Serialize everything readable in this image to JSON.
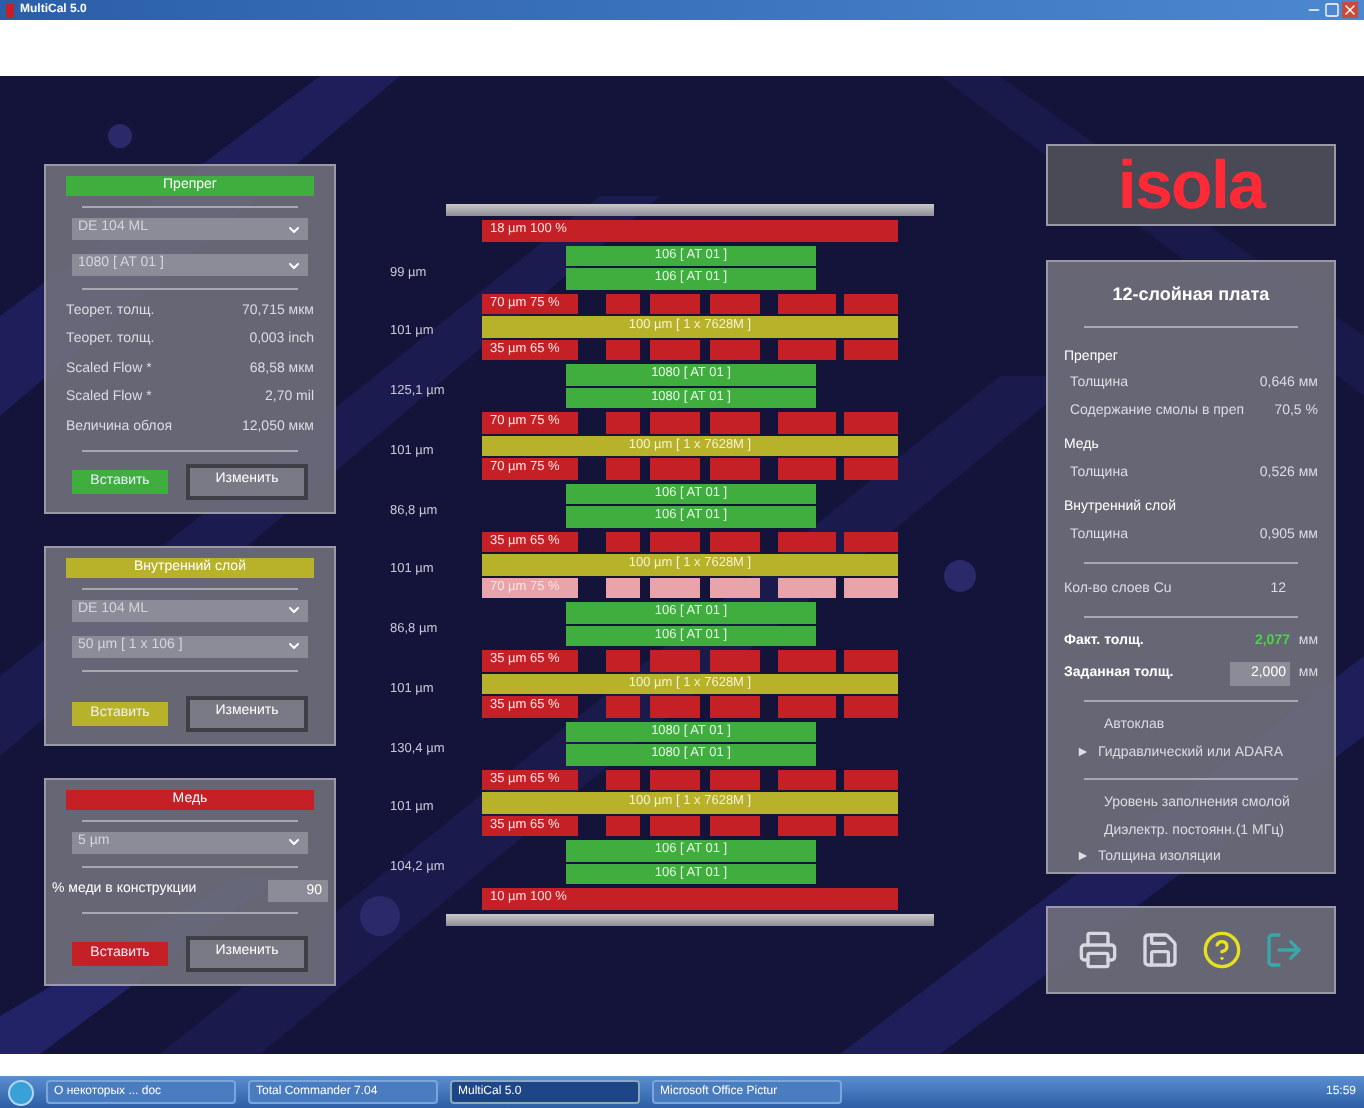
{
  "window": {
    "title": "MultiCal 5.0"
  },
  "left_panels": [
    {
      "header": "Препрег",
      "color": "#3fae3f",
      "dropdowns": [
        "DE 104 ML",
        "1080 [ AT 01 ]"
      ],
      "row_groups": [
        [
          {
            "label": "Теорет. толщ.",
            "value": "70,715 мкм"
          },
          {
            "label": "Теорет. толщ.",
            "value": "0,003 inch"
          }
        ],
        [
          {
            "label": "Scaled Flow *",
            "value": "68,58 мкм"
          },
          {
            "label": "Scaled Flow *",
            "value": "2,70 mil"
          }
        ],
        [
          {
            "label": "Величина облоя",
            "value": "12,050 мкм"
          }
        ]
      ],
      "insert_button": "Вставить",
      "change_button": "Изменить"
    },
    {
      "header": "Внутренний слой",
      "color": "#b8b22a",
      "dropdowns": [
        "DE 104 ML",
        "50 µm  [ 1 x  106 ]"
      ],
      "insert_button": "Вставить",
      "change_button": "Изменить"
    },
    {
      "header": "Медь",
      "color": "#c42026",
      "dropdowns": [
        "5 µm"
      ],
      "copper_share": {
        "label": "% меди в конструкции",
        "value": "90"
      },
      "insert_button": "Вставить",
      "change_button": "Изменить"
    }
  ],
  "stack": [
    {
      "layers": [
        {
          "kind": "foil",
          "label": "18 µm 100 %"
        }
      ]
    },
    {
      "thickness": "99 µm",
      "layers": [
        {
          "kind": "prepreg",
          "label": "106  [ AT 01 ]"
        },
        {
          "kind": "prepreg",
          "label": "106  [ AT 01 ]"
        }
      ]
    },
    {
      "thickness": "101 µm",
      "layers": [
        {
          "kind": "pattern",
          "label": "70 µm 75 %",
          "color": "#c42026"
        },
        {
          "kind": "core",
          "label": "100 µm  [ 1 x 7628M ]"
        },
        {
          "kind": "pattern",
          "label": "35 µm 65 %",
          "color": "#c42026"
        }
      ]
    },
    {
      "thickness": "125,1 µm",
      "layers": [
        {
          "kind": "prepreg",
          "label": "1080  [ AT 01 ]"
        },
        {
          "kind": "prepreg",
          "label": "1080  [ AT 01 ]"
        }
      ]
    },
    {
      "thickness": "101 µm",
      "layers": [
        {
          "kind": "pattern",
          "label": "70 µm 75 %",
          "color": "#c42026"
        },
        {
          "kind": "core",
          "label": "100 µm  [ 1 x 7628M ]"
        },
        {
          "kind": "pattern",
          "label": "70 µm 75 %",
          "color": "#c42026"
        }
      ]
    },
    {
      "thickness": "86,8 µm",
      "layers": [
        {
          "kind": "prepreg",
          "label": "106  [ AT 01 ]"
        },
        {
          "kind": "prepreg",
          "label": "106  [ AT 01 ]"
        }
      ]
    },
    {
      "thickness": "101 µm",
      "layers": [
        {
          "kind": "pattern",
          "label": "35 µm 65 %",
          "color": "#c42026"
        },
        {
          "kind": "core",
          "label": "100 µm  [ 1 x 7628M ]"
        },
        {
          "kind": "pattern",
          "label": "70 µm 75 %",
          "color": "#e8a3ab"
        }
      ]
    },
    {
      "thickness": "86,8 µm",
      "layers": [
        {
          "kind": "prepreg",
          "label": "106  [ AT 01 ]"
        },
        {
          "kind": "prepreg",
          "label": "106  [ AT 01 ]"
        }
      ]
    },
    {
      "thickness": "101 µm",
      "layers": [
        {
          "kind": "pattern",
          "label": "35 µm 65 %",
          "color": "#c42026"
        },
        {
          "kind": "core",
          "label": "100 µm  [ 1 x 7628M ]"
        },
        {
          "kind": "pattern",
          "label": "35 µm 65 %",
          "color": "#c42026"
        }
      ]
    },
    {
      "thickness": "130,4 µm",
      "layers": [
        {
          "kind": "prepreg",
          "label": "1080  [ AT 01 ]"
        },
        {
          "kind": "prepreg",
          "label": "1080  [ AT 01 ]"
        }
      ]
    },
    {
      "thickness": "101 µm",
      "layers": [
        {
          "kind": "pattern",
          "label": "35 µm 65 %",
          "color": "#c42026"
        },
        {
          "kind": "core",
          "label": "100 µm  [ 1 x 7628M ]"
        },
        {
          "kind": "pattern",
          "label": "35 µm 65 %",
          "color": "#c42026"
        }
      ]
    },
    {
      "thickness": "104,2 µm",
      "layers": [
        {
          "kind": "prepreg",
          "label": "106  [ AT 01 ]"
        },
        {
          "kind": "prepreg",
          "label": "106  [ AT 01 ]"
        }
      ]
    },
    {
      "layers": [
        {
          "kind": "foil",
          "label": "10 µm 100 %"
        }
      ]
    }
  ],
  "logo": "isola",
  "summary": {
    "title": "12-слойная плата",
    "sections": [
      {
        "heading": "Препрег",
        "rows": [
          {
            "label": "Толщина",
            "value": "0,646 мм"
          },
          {
            "label": "Содержание смолы в преп",
            "value": "70,5 %"
          }
        ]
      },
      {
        "heading": "Медь",
        "rows": [
          {
            "label": "Толщина",
            "value": "0,526 мм"
          }
        ]
      },
      {
        "heading": "Внутренний слой",
        "rows": [
          {
            "label": "Толщина",
            "value": "0,905 мм"
          }
        ]
      }
    ],
    "layer_count": {
      "label": "Кол-во слоев Cu",
      "value": "12"
    },
    "actual": {
      "label": "Факт. толщ.",
      "value": "2,077",
      "unit": "мм"
    },
    "target": {
      "label": "Заданная толщ.",
      "value": "2,000",
      "unit": "мм"
    },
    "autoclave": {
      "heading": "Автоклав",
      "marker": "►",
      "option": "Гидравлический или ADARA"
    },
    "options": [
      {
        "label": "Уровень заполнения смолой"
      },
      {
        "label": "Диэлектр. постоянн.(1 МГц)"
      },
      {
        "marker": "►",
        "label": "Толщина изоляции"
      }
    ]
  },
  "taskbar": {
    "items": [
      {
        "label": "О некоторых ... doc",
        "selected": false
      },
      {
        "label": "Total Commander 7.04",
        "selected": false
      },
      {
        "label": "MultiCal 5.0",
        "selected": true
      },
      {
        "label": "Microsoft Office Pictur",
        "selected": false
      }
    ],
    "clock": "15:59"
  }
}
